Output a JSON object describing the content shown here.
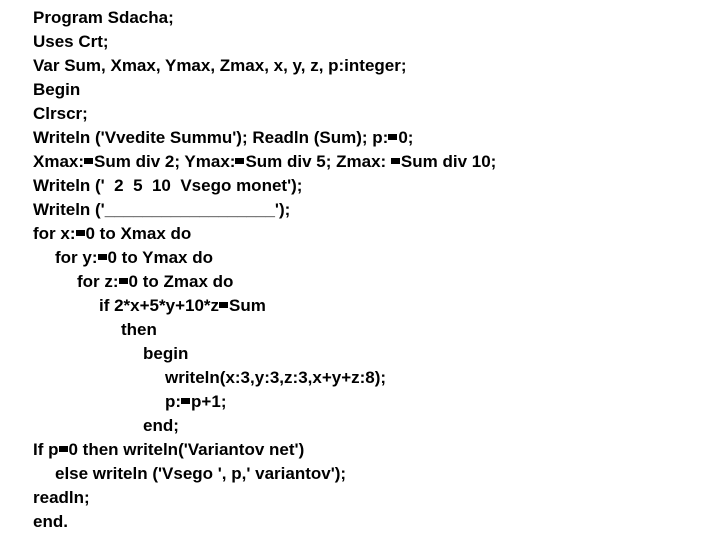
{
  "document": {
    "kind": "source-code-listing",
    "language": "Pascal",
    "program_name": "Sdacha",
    "background_color": "#ffffff",
    "text_color": "#000000",
    "missing_glyph_note": "The '=' character renders as a solid filled rectangle (missing glyph box)"
  },
  "code": {
    "lines": [
      {
        "indent": 0,
        "text": "Program Sdacha;"
      },
      {
        "indent": 0,
        "text": "Uses Crt;"
      },
      {
        "indent": 0,
        "text": "Var Sum, Xmax, Ymax, Zmax, x, y, z, p:integer;"
      },
      {
        "indent": 0,
        "text": "Begin"
      },
      {
        "indent": 0,
        "text": "Clrscr;"
      },
      {
        "indent": 0,
        "text": "Writeln ('Vvedite Summu'); Readln (Sum); p:=0;"
      },
      {
        "indent": 0,
        "text": "Xmax:=Sum div 2; Ymax:=Sum div 5; Zmax: =Sum div 10;"
      },
      {
        "indent": 0,
        "text": "Writeln ('  2  5  10  Vsego monet');"
      },
      {
        "indent": 0,
        "text": "Writeln ('__________________');"
      },
      {
        "indent": 0,
        "text": "for x:=0 to Xmax do"
      },
      {
        "indent": 1,
        "text": "for y:=0 to Ymax do"
      },
      {
        "indent": 2,
        "text": "for z:=0 to Zmax do"
      },
      {
        "indent": 3,
        "text": "if 2*x+5*y+10*z=Sum"
      },
      {
        "indent": 4,
        "text": "then"
      },
      {
        "indent": 5,
        "text": "begin"
      },
      {
        "indent": 6,
        "text": "writeln(x:3,y:3,z:3,x+y+z:8);"
      },
      {
        "indent": 6,
        "text": "p:=p+1;"
      },
      {
        "indent": 5,
        "text": "end;"
      },
      {
        "indent": 0,
        "text": "If p=0 then writeln('Variantov net')"
      },
      {
        "indent": 1,
        "text": "else writeln ('Vsego ', p,' variantov');"
      },
      {
        "indent": 0,
        "text": "readln;"
      },
      {
        "indent": 0,
        "text": "end."
      }
    ]
  }
}
